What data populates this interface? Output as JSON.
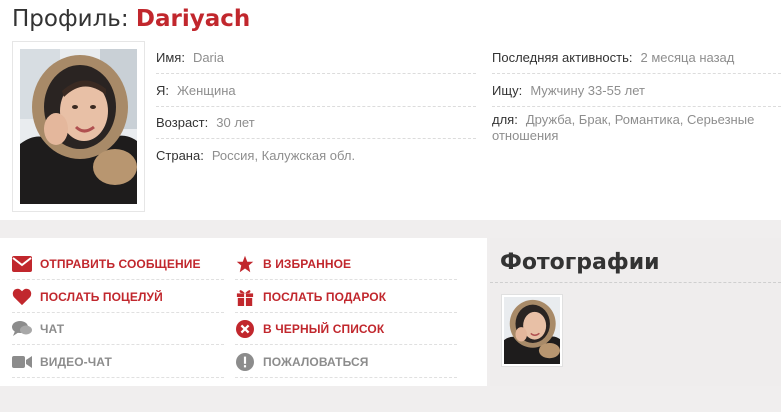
{
  "profile": {
    "title_prefix": "Профиль:",
    "username": "Dariyach",
    "left_fields": [
      {
        "label": "Имя:",
        "value": "Daria"
      },
      {
        "label": "Я:",
        "value": "Женщина"
      },
      {
        "label": "Возраст:",
        "value": "30 лет"
      },
      {
        "label": "Страна:",
        "value": "Россия, Калужская обл."
      }
    ],
    "right_fields": [
      {
        "label": "Последняя активность:",
        "value": "2 месяца назад"
      },
      {
        "label": "Ищу:",
        "value": "Мужчину 33-55 лет"
      },
      {
        "label": "для:",
        "value": "Дружба, Брак, Романтика, Серьезные отношения"
      }
    ]
  },
  "actions": [
    {
      "label": "ОТПРАВИТЬ СООБЩЕНИЕ",
      "icon": "envelope-icon"
    },
    {
      "label": "В ИЗБРАННОЕ",
      "icon": "star-icon"
    },
    {
      "label": "ПОСЛАТЬ ПОЦЕЛУЙ",
      "icon": "heart-icon"
    },
    {
      "label": "ПОСЛАТЬ ПОДАРОК",
      "icon": "gift-icon"
    },
    {
      "label": "ЧАТ",
      "icon": "chat-bubbles-icon"
    },
    {
      "label": "В ЧЕРНЫЙ СПИСОК",
      "icon": "x-circle-icon"
    },
    {
      "label": "ВИДЕО-ЧАТ",
      "icon": "video-camera-icon"
    },
    {
      "label": "ПОЖАЛОВАТЬСЯ",
      "icon": "exclamation-circle-icon"
    }
  ],
  "photos": {
    "title": "Фотографии"
  },
  "colors": {
    "accent": "#c1272d",
    "muted": "#8c8c8c"
  }
}
